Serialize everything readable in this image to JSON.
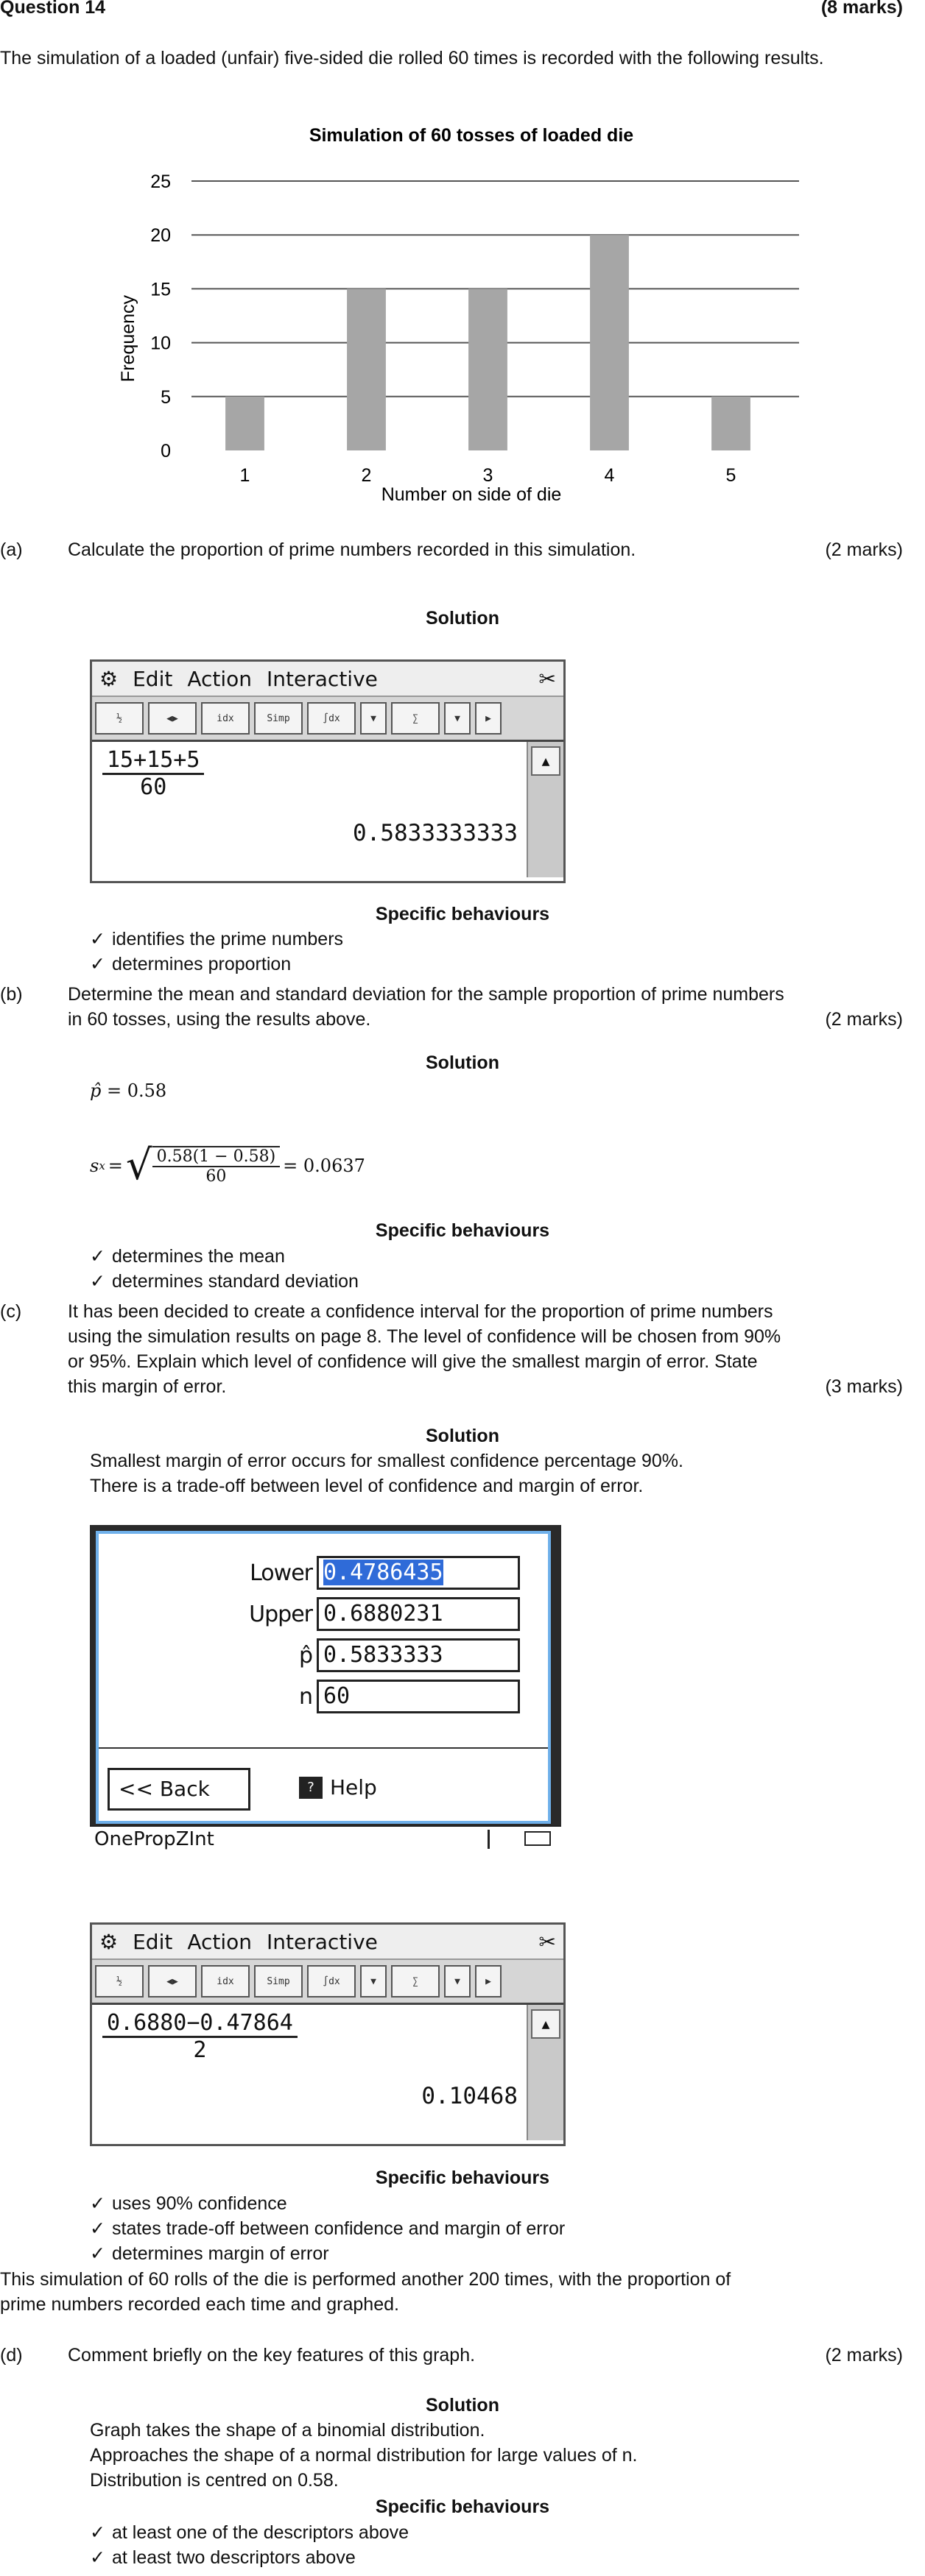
{
  "header": {
    "question": "Question 14",
    "marks": "(8 marks)"
  },
  "intro": "The simulation of a loaded (unfair) five-sided die rolled 60 times is recorded with the following results.",
  "chart_data": {
    "type": "bar",
    "title": "Simulation of 60 tosses of loaded die",
    "xlabel": "Number on side of die",
    "ylabel": "Frequency",
    "categories": [
      "1",
      "2",
      "3",
      "4",
      "5"
    ],
    "values": [
      5,
      15,
      15,
      20,
      5
    ],
    "ylim": [
      0,
      25
    ],
    "yticks": [
      "0",
      "5",
      "10",
      "15",
      "20",
      "25"
    ],
    "grid": true,
    "bar_color": "#a6a6a6"
  },
  "part_a": {
    "label": "(a)",
    "question": "Calculate the proportion of prime numbers recorded in this simulation.",
    "marks": "(2 marks)",
    "solution_heading": "Solution",
    "calc_menu": [
      "Edit",
      "Action",
      "Interactive"
    ],
    "calc_numerator": "15+15+5",
    "calc_denominator": "60",
    "calc_result": "0.5833333333",
    "behaviours_heading": "Specific behaviours",
    "behaviours": [
      "identifies the prime numbers",
      "determines proportion"
    ]
  },
  "part_b": {
    "label": "(b)",
    "question_line1": "Determine the mean and standard deviation for the sample proportion of prime numbers",
    "question_line2": "in 60 tosses, using the results above.",
    "marks": "(2 marks)",
    "solution_heading": "Solution",
    "mean_lhs": "p̂",
    "mean_rhs": "= 0.58",
    "sd_lhs": "s",
    "sd_sub": "x",
    "sd_num": "0.58(1 − 0.58)",
    "sd_den": "60",
    "sd_result": "= 0.0637",
    "behaviours_heading": "Specific behaviours",
    "behaviours": [
      "determines the mean",
      "determines standard deviation"
    ]
  },
  "part_c": {
    "label": "(c)",
    "question_line1": "It has been decided to create a confidence interval for the proportion of prime numbers",
    "question_line2": "using the simulation results on page 8. The level of confidence will be chosen from 90%",
    "question_line3": "or 95%. Explain which level of confidence will give the smallest margin of error. State",
    "question_line4": "this margin of error.",
    "marks": "(3 marks)",
    "solution_heading": "Solution",
    "solution_line1": "Smallest margin of error occurs for smallest confidence percentage 90%.",
    "solution_line2": "There is a trade-off between level of confidence and margin of error.",
    "dialog": {
      "lower_label": "Lower",
      "lower_value": "0.4786435",
      "upper_label": "Upper",
      "upper_value": "0.6880231",
      "phat_label": "p̂",
      "phat_value": "0.5833333",
      "n_label": "n",
      "n_value": "60",
      "back_label": "<< Back",
      "help_label": "Help",
      "status": "OnePropZInt"
    },
    "calc_menu": [
      "Edit",
      "Action",
      "Interactive"
    ],
    "calc_numerator": "0.6880−0.47864",
    "calc_denominator": "2",
    "calc_result": "0.10468",
    "behaviours_heading": "Specific behaviours",
    "behaviours": [
      "uses 90% confidence",
      "states trade-off between confidence and margin of error",
      "determines margin of error"
    ]
  },
  "part_d_intro_line1": "This simulation of 60 rolls of the die is performed another 200 times, with the proportion of",
  "part_d_intro_line2": "prime numbers recorded each time and graphed.",
  "part_d": {
    "label": "(d)",
    "question": "Comment briefly on the key features of this graph.",
    "marks": "(2 marks)",
    "solution_heading": "Solution",
    "solution_line1": "Graph takes the shape of a binomial distribution.",
    "solution_line2": "Approaches the shape of a normal distribution for large values of n.",
    "solution_line3": "Distribution is centred on 0.58.",
    "behaviours_heading": "Specific behaviours",
    "behaviours": [
      "at least one of the descriptors above",
      "at least two descriptors above"
    ]
  }
}
